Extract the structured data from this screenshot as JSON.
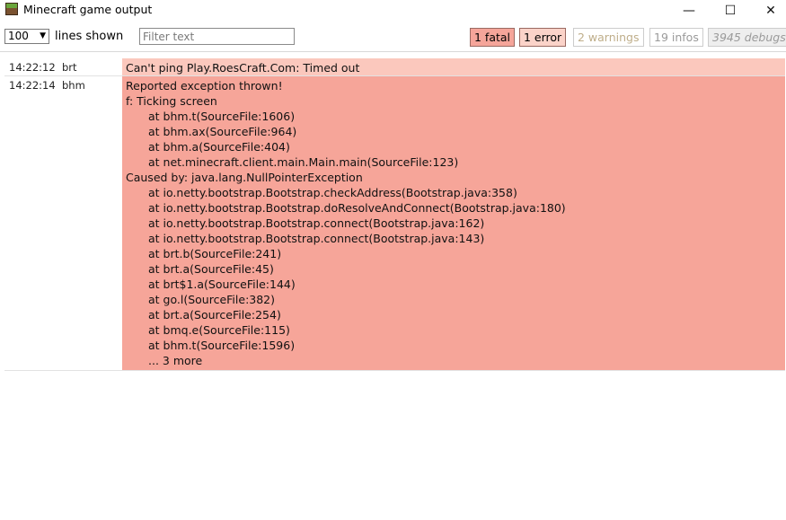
{
  "window": {
    "title": "Minecraft game output",
    "minimize_glyph": "—",
    "maximize_glyph": "☐",
    "close_glyph": "✕"
  },
  "toolbar": {
    "lines_value": "100",
    "lines_label": "lines shown",
    "filter_placeholder": "Filter text",
    "filter_value": "",
    "counters": {
      "fatal": "1 fatal",
      "error": "1 error",
      "warnings": "2 warnings",
      "infos": "19 infos",
      "debugs": "3945 debugs"
    }
  },
  "log": {
    "entries": [
      {
        "time": "14:22:12",
        "source": "brt",
        "level": "error",
        "message": "Can't ping Play.RoesCraft.Com: Timed out"
      },
      {
        "time": "14:22:14",
        "source": "bhm",
        "level": "fatal",
        "lines": [
          "Reported exception thrown!",
          "f: Ticking screen",
          "at bhm.t(SourceFile:1606)",
          "at bhm.ax(SourceFile:964)",
          "at bhm.a(SourceFile:404)",
          "at net.minecraft.client.main.Main.main(SourceFile:123)",
          "Caused by: java.lang.NullPointerException",
          "at io.netty.bootstrap.Bootstrap.checkAddress(Bootstrap.java:358)",
          "at io.netty.bootstrap.Bootstrap.doResolveAndConnect(Bootstrap.java:180)",
          "at io.netty.bootstrap.Bootstrap.connect(Bootstrap.java:162)",
          "at io.netty.bootstrap.Bootstrap.connect(Bootstrap.java:143)",
          "at brt.b(SourceFile:241)",
          "at brt.a(SourceFile:45)",
          "at brt$1.a(SourceFile:144)",
          "at go.l(SourceFile:382)",
          "at brt.a(SourceFile:254)",
          "at bmq.e(SourceFile:115)",
          "at bhm.t(SourceFile:1596)",
          "... 3 more"
        ]
      }
    ]
  },
  "colors": {
    "fatal_bg": "#f6a599",
    "error_bg": "#fbc8bd"
  }
}
